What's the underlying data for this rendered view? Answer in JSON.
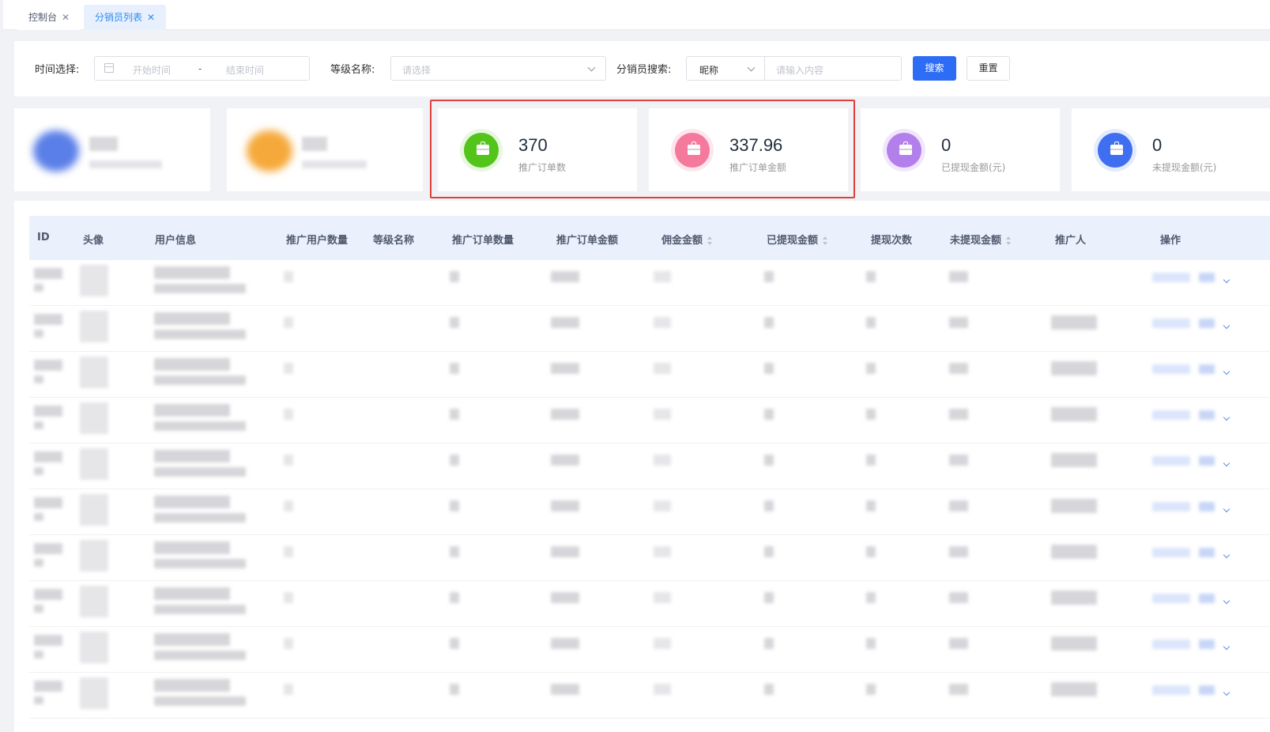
{
  "tabs": [
    {
      "label": "控制台"
    },
    {
      "label": "分销员列表",
      "active": true
    }
  ],
  "filter": {
    "time_label": "时间选择:",
    "start_placeholder": "开始时间",
    "range_sep": "-",
    "end_placeholder": "结束时间",
    "level_label": "等级名称:",
    "level_placeholder": "请选择",
    "search_label": "分销员搜索:",
    "search_type": "昵称",
    "search_placeholder": "请输入内容",
    "search_button": "搜索",
    "reset_button": "重置"
  },
  "stats": [
    {
      "value": "370",
      "label": "推广订单数",
      "color": "#52c41a",
      "ring": "#e8f7e0"
    },
    {
      "value": "337.96",
      "label": "推广订单金额",
      "color": "#f5799c",
      "ring": "#fde6ee"
    },
    {
      "value": "0",
      "label": "已提现金额(元)",
      "color": "#b37feb",
      "ring": "#f1e6fc"
    },
    {
      "value": "0",
      "label": "未提现金额(元)",
      "color": "#3f6ef0",
      "ring": "#e3ebfd"
    }
  ],
  "table": {
    "columns": [
      "ID",
      "头像",
      "用户信息",
      "推广用户数量",
      "等级名称",
      "推广订单数量",
      "推广订单金额",
      "佣金金额",
      "已提现金额",
      "提现次数",
      "未提现金额",
      "推广人",
      "操作"
    ],
    "sortable_columns": [
      "佣金金额",
      "已提现金额",
      "未提现金额"
    ]
  },
  "colors": {
    "primary": "#2d6cf5",
    "highlight_border": "#e0403a",
    "header_bg": "#eaf0fc"
  }
}
